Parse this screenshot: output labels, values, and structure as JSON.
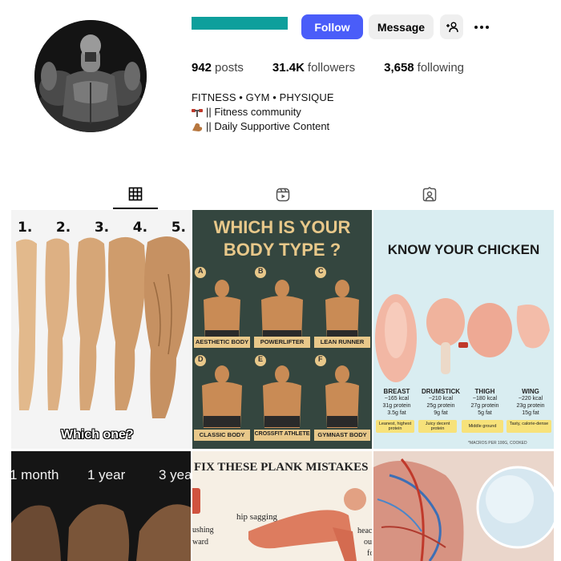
{
  "profile": {
    "avatar_icon": "bodybuilder-portrait",
    "username_color": "#0e9f9c",
    "follow_label": "Follow",
    "message_label": "Message",
    "add_user_icon": "person-add-icon",
    "more_icon": "more-horizontal-icon",
    "accent_color": "#4a5df9"
  },
  "stats": {
    "posts_count": "942",
    "posts_label": "posts",
    "followers_count": "31.4K",
    "followers_label": "followers",
    "following_count": "3,658",
    "following_label": "following"
  },
  "bio": {
    "category": "FITNESS • GYM • PHYSIQUE",
    "line1": "|| Fitness community",
    "line1_icon": "dumbbell-icon",
    "line2": "|| Daily Supportive Content",
    "line2_icon": "flexed-biceps-icon"
  },
  "tabs": [
    {
      "icon": "grid-icon",
      "active": true
    },
    {
      "icon": "reels-icon",
      "active": false
    },
    {
      "icon": "tagged-icon",
      "active": false
    }
  ],
  "posts": {
    "arms": {
      "numbers": [
        "1.",
        "2.",
        "3.",
        "4.",
        "5."
      ],
      "caption": "Which one?"
    },
    "body_type": {
      "title_line1": "WHICH IS YOUR",
      "title_line2": "BODY TYPE ?",
      "types": [
        {
          "letter": "A",
          "label": "AESTHETIC BODY"
        },
        {
          "letter": "B",
          "label": "POWERLIFTER"
        },
        {
          "letter": "C",
          "label": "LEAN RUNNER"
        },
        {
          "letter": "D",
          "label": "CLASSIC BODY"
        },
        {
          "letter": "E",
          "label": "CROSSFIT ATHLETE"
        },
        {
          "letter": "F",
          "label": "GYMNAST BODY"
        }
      ]
    },
    "chicken": {
      "title": "KNOW YOUR CHICKEN",
      "cuts": [
        {
          "name": "BREAST",
          "kcal": "~165 kcal",
          "protein": "31g protein",
          "fat": "3.5g fat",
          "tag": "Leanest, highest protein"
        },
        {
          "name": "DRUMSTICK",
          "kcal": "~210 kcal",
          "protein": "25g protein",
          "fat": "9g fat",
          "tag": "Juicy decent protein"
        },
        {
          "name": "THIGH",
          "kcal": "~180 kcal",
          "protein": "27g protein",
          "fat": "5g fat",
          "tag": "Middle ground"
        },
        {
          "name": "WING",
          "kcal": "~220 kcal",
          "protein": "23g protein",
          "fat": "15g fat",
          "tag": "Tasty, calorie-dense"
        }
      ],
      "footnote": "*MACROS PER 100G, COOKED"
    },
    "progress": {
      "labels": [
        "1 month",
        "1 year",
        "3 yea"
      ]
    },
    "plank": {
      "title": "FIX THESE PLANK MISTAKES",
      "notes": [
        "hip sagging",
        "ushing",
        "ward",
        "heac",
        "ou",
        "fo"
      ]
    },
    "anatomy": {
      "icon": "anatomy-illustration"
    }
  }
}
